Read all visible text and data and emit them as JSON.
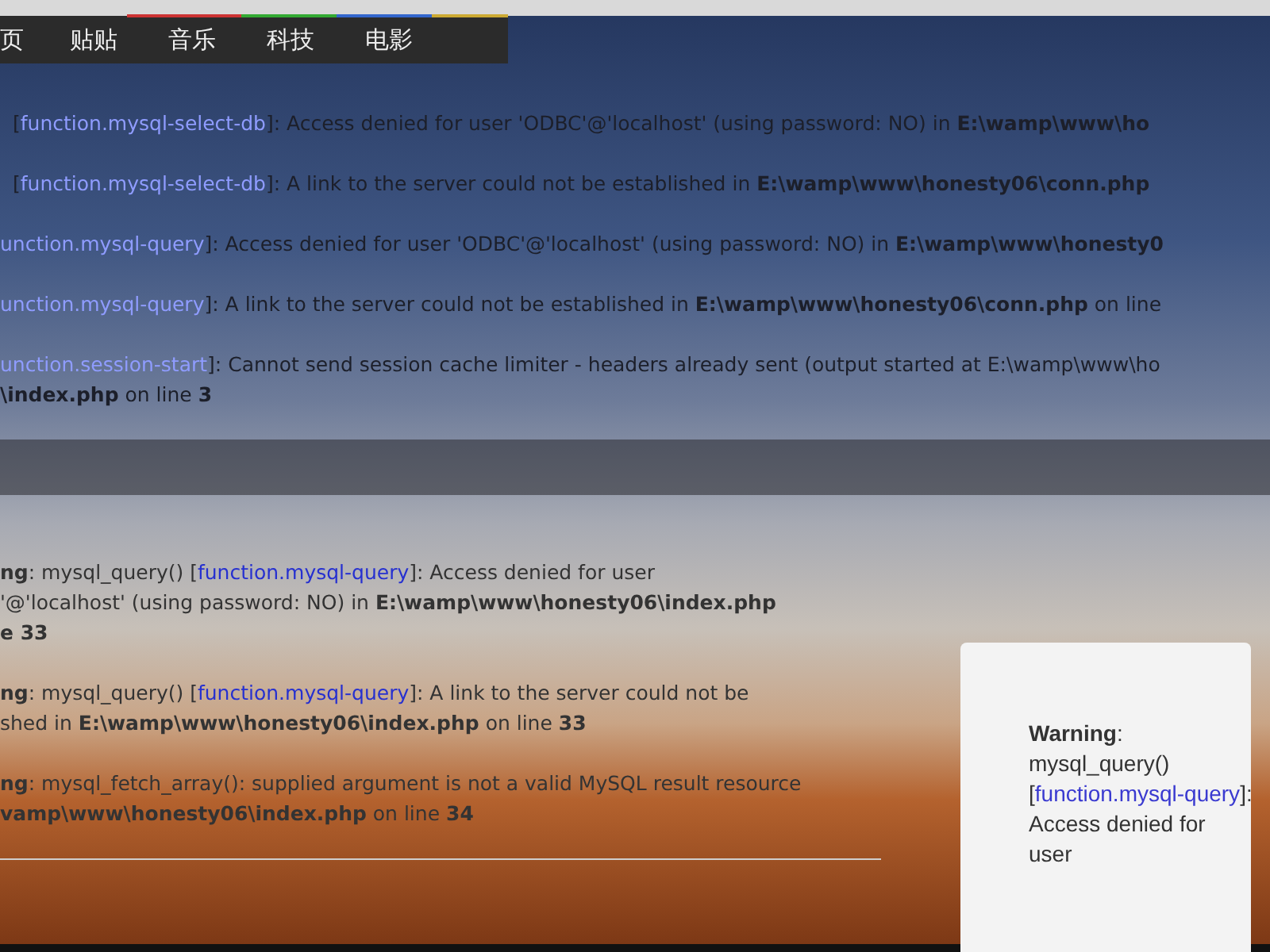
{
  "nav": {
    "items": [
      "页",
      "贴贴",
      "音乐",
      "科技",
      "电影"
    ]
  },
  "errors_top": [
    {
      "lines": [
        {
          "before": "[",
          "link": "function.mysql-select-db",
          "after": "]: Access denied for user 'ODBC'@'localhost' (using password: NO) in **E:\\wamp\\www\\ho**"
        }
      ]
    },
    {
      "lines": [
        {
          "before": "[",
          "link": "function.mysql-select-db",
          "after": "]: A link to the server could not be established in **E:\\wamp\\www\\honesty06\\conn.php**"
        }
      ]
    },
    {
      "lines": [
        {
          "link": "unction.mysql-query",
          "after": "]: Access denied for user 'ODBC'@'localhost' (using password: NO) in **E:\\wamp\\www\\honesty0**"
        }
      ]
    },
    {
      "lines": [
        {
          "link": "unction.mysql-query",
          "after": "]: A link to the server could not be established in **E:\\wamp\\www\\honesty06\\conn.php** on line"
        }
      ]
    },
    {
      "lines": [
        {
          "link": "unction.session-start",
          "after": "]: Cannot send session cache limiter - headers already sent (output started at E:\\wamp\\www\\ho"
        },
        {
          "after": "**\\index.php** on line **3**"
        }
      ]
    }
  ],
  "errors_bottom": [
    {
      "lines": [
        {
          "before": "**ng**: mysql_query() [",
          "link": "function.mysql-query",
          "after": "]: Access denied for user"
        },
        {
          "after": "'@'localhost' (using password: NO) in **E:\\wamp\\www\\honesty06\\index.php**"
        },
        {
          "after": "**e 33**"
        }
      ]
    },
    {
      "lines": [
        {
          "before": "**ng**: mysql_query() [",
          "link": "function.mysql-query",
          "after": "]: A link to the server could not be"
        },
        {
          "after": "shed in **E:\\wamp\\www\\honesty06\\index.php** on line **33**"
        }
      ]
    },
    {
      "lines": [
        {
          "before": "**ng**: mysql_fetch_array(): supplied argument is not a valid MySQL result resource"
        },
        {
          "after": "**vamp\\www\\honesty06\\index.php** on line **34**"
        }
      ]
    }
  ],
  "popup": {
    "before": "**Warning**: mysql_query() [",
    "link": "function.mysql-query",
    "after": "]: Access denied for user"
  }
}
